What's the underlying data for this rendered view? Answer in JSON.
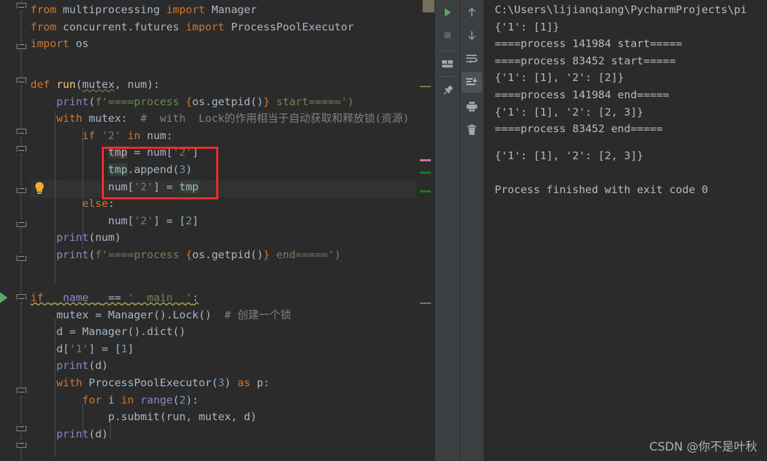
{
  "editor": {
    "language": "python",
    "lines": [
      "from multiprocessing import Manager",
      "from concurrent.futures import ProcessPoolExecutor",
      "import os",
      "",
      "",
      "def run(mutex, num):",
      "    print(f'====process {os.getpid()} start=====')",
      "    with mutex:  # with Lock的作用相当于自动获取和释放锁(资源)",
      "        if '2' in num:",
      "            tmp = num['2']",
      "            tmp.append(3)",
      "            num['2'] = tmp",
      "        else:",
      "            num['2'] = [2]",
      "    print(num)",
      "    print(f'====process {os.getpid()} end=====')",
      "",
      "",
      "if __name__ == '__main__':",
      "    mutex = Manager().Lock()  # 创建一个锁",
      "    d = Manager().dict()",
      "    d['1'] = [1]",
      "    print(d)",
      "    with ProcessPoolExecutor(3) as p:",
      "        for i in range(2):",
      "            p.submit(run, mutex, d)",
      "    print(d)"
    ],
    "highlighted_identifier": "tmp",
    "current_line_number": 12,
    "comments": {
      "with_lock": "# with Lock的作用相当于自动获取和释放锁(资源)",
      "create_lock": "# 创建一个锁"
    }
  },
  "console": {
    "lines": [
      "C:\\Users\\lijianqiang\\PycharmProjects\\pi",
      "{'1': [1]}",
      "====process 141984 start=====",
      "====process 83452 start=====",
      "{'1': [1], '2': [2]}",
      "====process 141984 end=====",
      "{'1': [1], '2': [2, 3]}",
      "====process 83452 end=====",
      "{'1': [1], '2': [2, 3]}",
      "",
      "Process finished with exit code 0"
    ],
    "highlighted_line_index": 8
  },
  "toolbar": {
    "left_buttons": [
      {
        "name": "rerun-button",
        "label": "Rerun"
      },
      {
        "name": "stop-button",
        "label": "Stop"
      },
      {
        "name": "layout-button",
        "label": "Layout Settings"
      },
      {
        "name": "pin-tab-button",
        "label": "Pin Tab"
      }
    ],
    "right_buttons": [
      {
        "name": "up-arrow-button",
        "label": "Up"
      },
      {
        "name": "down-arrow-button",
        "label": "Down"
      },
      {
        "name": "soft-wrap-button",
        "label": "Soft-Wrap"
      },
      {
        "name": "scroll-to-end-button",
        "label": "Scroll to End"
      },
      {
        "name": "print-button",
        "label": "Print"
      },
      {
        "name": "clear-all-button",
        "label": "Clear All"
      }
    ],
    "selected_button": "scroll-to-end-button"
  },
  "annotations": {
    "editor_box_label": "highlighted code block",
    "console_box_label": "highlighted output line"
  },
  "watermark": {
    "text": "CSDN @你不是叶秋"
  },
  "colors": {
    "editor_background": "#2b2b2b",
    "toolbar_background": "#3c3f41",
    "keyword": "#cc7832",
    "string": "#6a8759",
    "number": "#6897bb",
    "comment": "#808080",
    "function": "#ffc66d",
    "builtin": "#8888c6",
    "default_text": "#a9b7c6",
    "console_text": "#bbbbbb",
    "annotation_red": "#fb2b2b",
    "run_green": "#59a869",
    "lightbulb_amber": "#f5ab35"
  }
}
